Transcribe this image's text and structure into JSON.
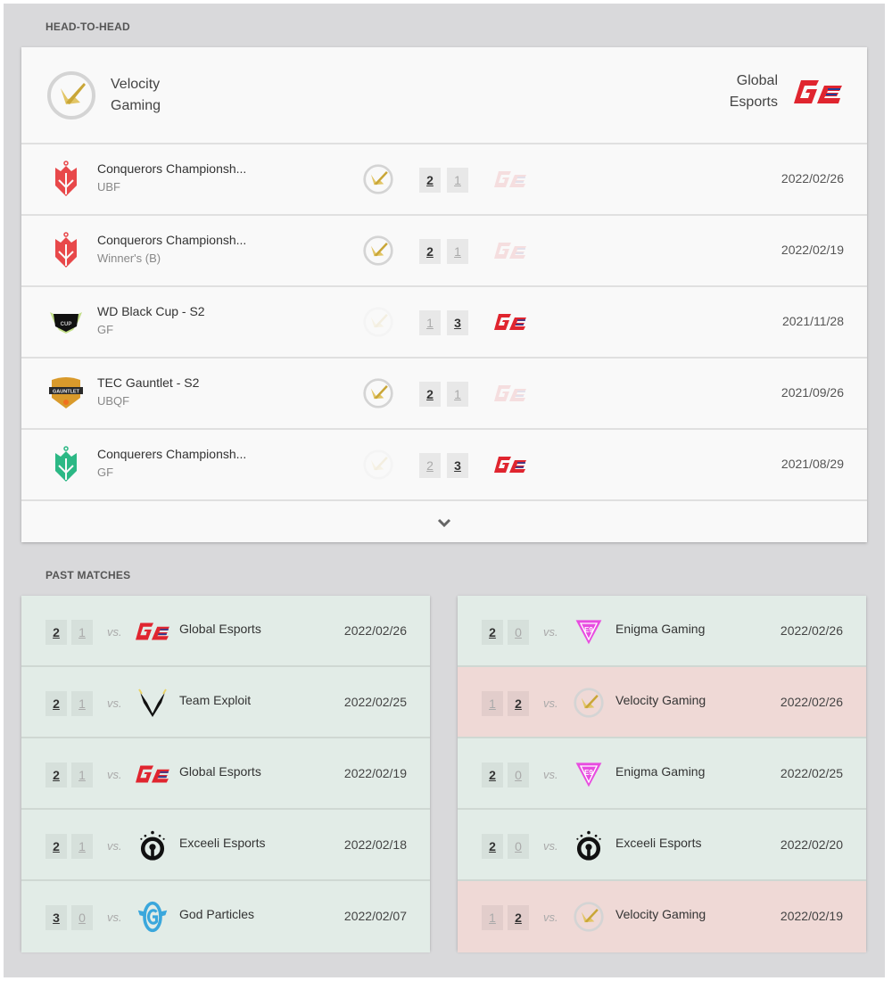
{
  "head_to_head": {
    "title": "HEAD-TO-HEAD",
    "team_left": {
      "name_line1": "Velocity",
      "name_line2": "Gaming",
      "logo": "velocity-gaming-logo"
    },
    "team_right": {
      "name_line1": "Global",
      "name_line2": "Esports",
      "logo": "global-esports-logo"
    },
    "matches": [
      {
        "event": "Conquerors Championsh...",
        "stage": "UBF",
        "event_logo": "conquerors-red-logo",
        "score_left": "2",
        "score_right": "1",
        "winner": "left",
        "date": "2022/02/26"
      },
      {
        "event": "Conquerors Championsh...",
        "stage": "Winner's (B)",
        "event_logo": "conquerors-red-logo",
        "score_left": "2",
        "score_right": "1",
        "winner": "left",
        "date": "2022/02/19"
      },
      {
        "event": "WD Black Cup - S2",
        "stage": "GF",
        "event_logo": "wd-black-cup-logo",
        "score_left": "1",
        "score_right": "3",
        "winner": "right",
        "date": "2021/11/28"
      },
      {
        "event": "TEC Gauntlet - S2",
        "stage": "UBQF",
        "event_logo": "tec-gauntlet-logo",
        "score_left": "2",
        "score_right": "1",
        "winner": "left",
        "date": "2021/09/26"
      },
      {
        "event": "Conquerers Championsh...",
        "stage": "GF",
        "event_logo": "conquerors-green-logo",
        "score_left": "2",
        "score_right": "3",
        "winner": "right",
        "date": "2021/08/29"
      }
    ],
    "expand_icon": "chevron-down-icon"
  },
  "past_matches": {
    "title": "PAST MATCHES",
    "vs_label": "vs.",
    "left": [
      {
        "score_a": "2",
        "score_b": "1",
        "result": "win",
        "opponent": "Global Esports",
        "logo": "global-esports",
        "date": "2022/02/26"
      },
      {
        "score_a": "2",
        "score_b": "1",
        "result": "win",
        "opponent": "Team Exploit",
        "logo": "team-exploit",
        "date": "2022/02/25"
      },
      {
        "score_a": "2",
        "score_b": "1",
        "result": "win",
        "opponent": "Global Esports",
        "logo": "global-esports",
        "date": "2022/02/19"
      },
      {
        "score_a": "2",
        "score_b": "1",
        "result": "win",
        "opponent": "Exceeli Esports",
        "logo": "exceeli-esports",
        "date": "2022/02/18"
      },
      {
        "score_a": "3",
        "score_b": "0",
        "result": "win",
        "opponent": "God Particles",
        "logo": "god-particles",
        "date": "2022/02/07"
      }
    ],
    "right": [
      {
        "score_a": "2",
        "score_b": "0",
        "result": "win",
        "opponent": "Enigma Gaming",
        "logo": "enigma-gaming",
        "date": "2022/02/26"
      },
      {
        "score_a": "1",
        "score_b": "2",
        "result": "loss",
        "opponent": "Velocity Gaming",
        "logo": "velocity-gaming",
        "date": "2022/02/26"
      },
      {
        "score_a": "2",
        "score_b": "0",
        "result": "win",
        "opponent": "Enigma Gaming",
        "logo": "enigma-gaming",
        "date": "2022/02/25"
      },
      {
        "score_a": "2",
        "score_b": "0",
        "result": "win",
        "opponent": "Exceeli Esports",
        "logo": "exceeli-esports",
        "date": "2022/02/20"
      },
      {
        "score_a": "1",
        "score_b": "2",
        "result": "loss",
        "opponent": "Velocity Gaming",
        "logo": "velocity-gaming",
        "date": "2022/02/19"
      }
    ]
  },
  "colors": {
    "win_row": "#e2ece7",
    "loss_row": "#efd9d6",
    "global_red": "#e0252f",
    "global_blue": "#1f3f9a",
    "velocity_gold": "#d9b64a",
    "enigma_pink": "#e84de0",
    "god_blue": "#3aa7dc"
  }
}
